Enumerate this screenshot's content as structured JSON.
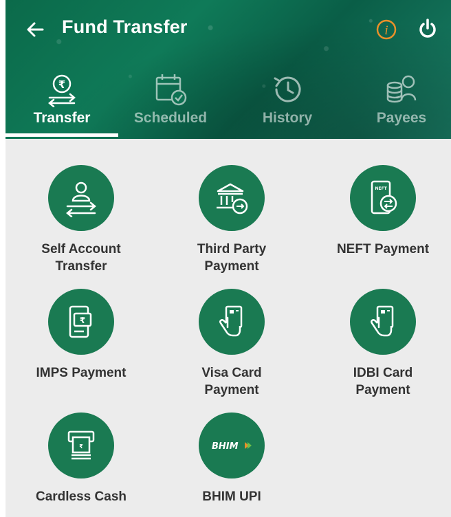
{
  "header": {
    "title": "Fund Transfer",
    "back_icon": "arrow-left-icon",
    "info_icon": "info-icon",
    "power_icon": "power-icon",
    "info_color": "#e8902a",
    "background_color": "#0f7a58"
  },
  "tabs": [
    {
      "label": "Transfer",
      "icon": "rupee-transfer-icon",
      "active": true
    },
    {
      "label": "Scheduled",
      "icon": "calendar-check-icon",
      "active": false
    },
    {
      "label": "History",
      "icon": "history-icon",
      "active": false
    },
    {
      "label": "Payees",
      "icon": "payees-icon",
      "active": false
    }
  ],
  "items": [
    {
      "label_line1": "Self Account",
      "label_line2": "Transfer",
      "icon": "self-transfer-icon"
    },
    {
      "label_line1": "Third Party",
      "label_line2": "Payment",
      "icon": "bank-transfer-icon"
    },
    {
      "label_line1": "NEFT Payment",
      "label_line2": "",
      "icon": "neft-icon",
      "icon_text": "NEFT"
    },
    {
      "label_line1": "IMPS Payment",
      "label_line2": "",
      "icon": "imps-icon"
    },
    {
      "label_line1": "Visa Card",
      "label_line2": "Payment",
      "icon": "card-tap-icon"
    },
    {
      "label_line1": "IDBI Card",
      "label_line2": "Payment",
      "icon": "card-tap-icon"
    },
    {
      "label_line1": "Cardless Cash",
      "label_line2": "",
      "icon": "atm-icon"
    },
    {
      "label_line1": "BHIM UPI",
      "label_line2": "",
      "icon": "bhim-logo",
      "icon_text": "BHIM"
    }
  ],
  "colors": {
    "accent": "#1a7a52",
    "content_bg": "#ececec",
    "label_text": "#333333"
  }
}
